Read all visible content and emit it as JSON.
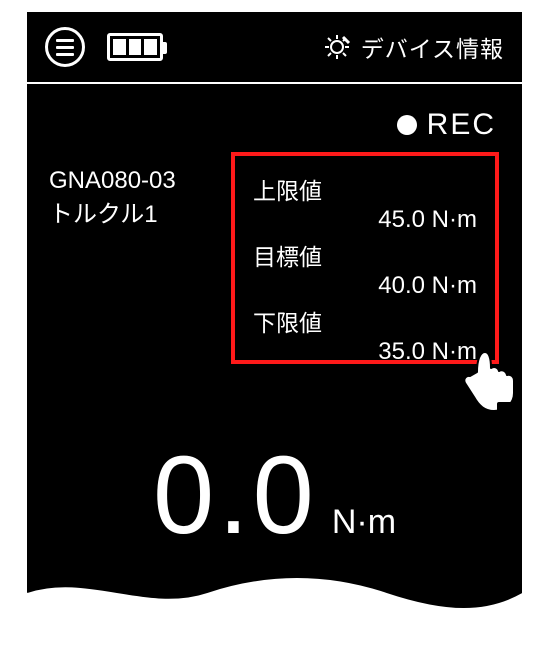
{
  "header": {
    "device_info_label": "デバイス情報"
  },
  "rec": {
    "label": "REC"
  },
  "device": {
    "model": "GNA080-03",
    "name": "トルクル1"
  },
  "limits": {
    "upper_label": "上限値",
    "upper_value": "45.0 N·m",
    "target_label": "目標値",
    "target_value": "40.0 N·m",
    "lower_label": "下限値",
    "lower_value": "35.0 N·m"
  },
  "reading": {
    "value": "0.0",
    "unit": "N·m"
  }
}
